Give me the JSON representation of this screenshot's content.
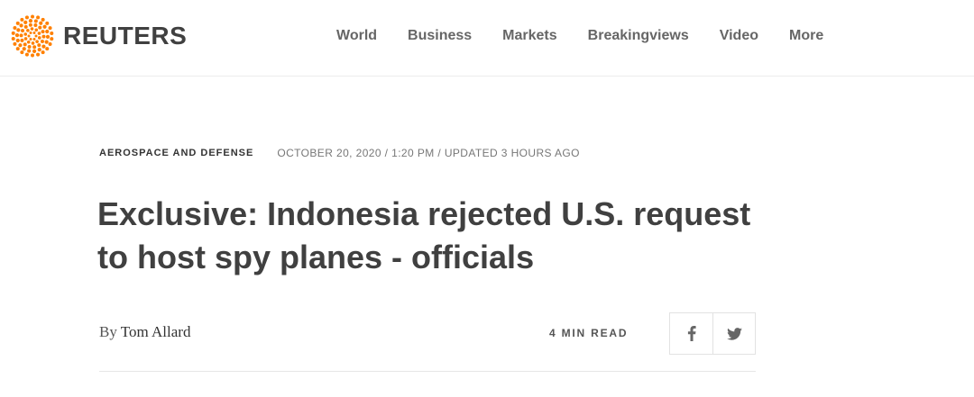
{
  "header": {
    "logo_text": "REUTERS",
    "nav": [
      "World",
      "Business",
      "Markets",
      "Breakingviews",
      "Video",
      "More"
    ]
  },
  "article": {
    "category": "AEROSPACE AND DEFENSE",
    "dateline": "OCTOBER 20, 2020 / 1:20 PM / UPDATED 3 HOURS AGO",
    "headline": "Exclusive: Indonesia rejected U.S. request to host spy planes - officials",
    "byline_prefix": "By",
    "author": "Tom Allard",
    "read_time": "4 MIN READ"
  },
  "share": {
    "icons": [
      "facebook-icon",
      "twitter-icon"
    ]
  },
  "colors": {
    "brand_orange": "#ff8000",
    "text_dark": "#404040",
    "nav_gray": "#666666"
  }
}
